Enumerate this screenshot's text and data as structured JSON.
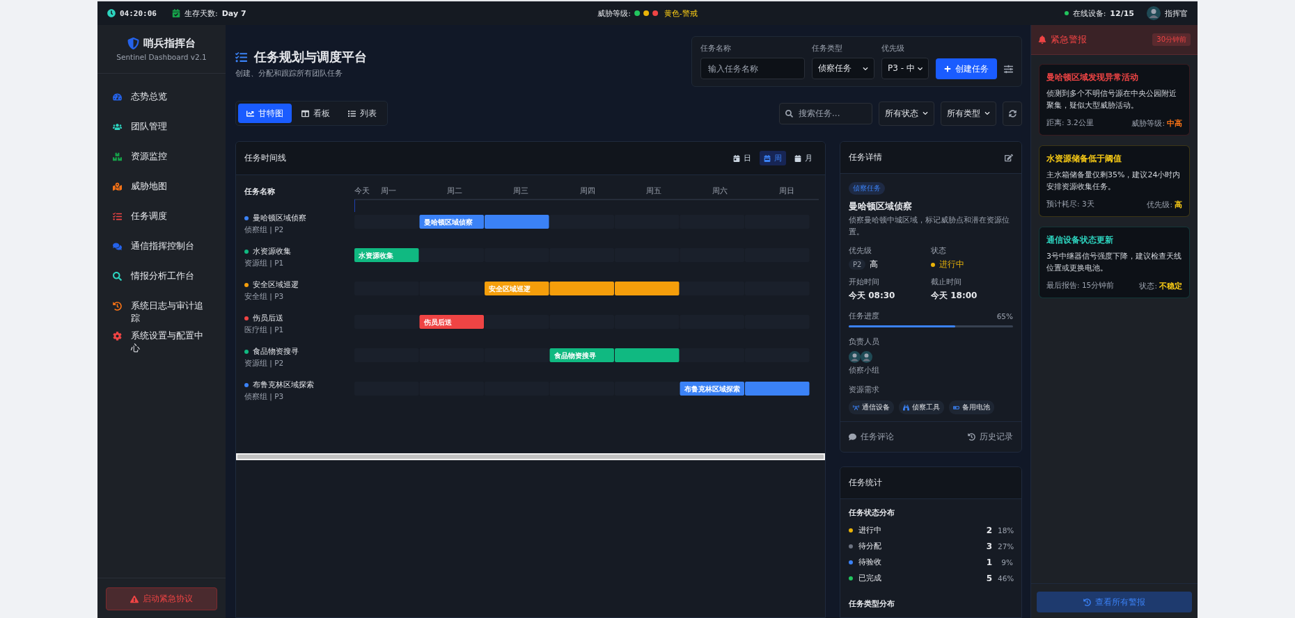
{
  "top_bar": {
    "clock": "04:20:06",
    "survival_label": "生存天数:",
    "survival_value": "Day 7",
    "threat_label": "威胁等级:",
    "threat_dots": [
      {
        "color": "#22c55e"
      },
      {
        "color": "#eab308"
      },
      {
        "color": "#ef4444"
      }
    ],
    "threat_text": "黄色-警戒",
    "devices_label": "在线设备:",
    "devices_value": "12/15",
    "user": "指挥官"
  },
  "sidebar": {
    "title": "哨兵指挥台",
    "subtitle": "Sentinel Dashboard v2.1",
    "items": [
      {
        "label": "态势总览",
        "color": "#2563eb",
        "selected": false
      },
      {
        "label": "团队管理",
        "color": "#2dd4bf",
        "selected": false
      },
      {
        "label": "资源监控",
        "color": "#16a34a",
        "selected": false
      },
      {
        "label": "威胁地图",
        "color": "#f97316",
        "selected": false
      },
      {
        "label": "任务调度",
        "color": "#ef4444",
        "selected": false
      },
      {
        "label": "通信指挥控制台",
        "color": "#2563eb",
        "selected": false
      },
      {
        "label": "情报分析工作台",
        "color": "#2dd4bf",
        "selected": false
      },
      {
        "label": "系统日志与审计追踪",
        "color": "#f97316",
        "selected": false
      },
      {
        "label": "系统设置与配置中心",
        "color": "#ef4444",
        "selected": false
      }
    ],
    "emergency_button": "启动紧急协议"
  },
  "header": {
    "title": "任务规划与调度平台",
    "subtitle": "创建、分配和跟踪所有团队任务"
  },
  "create_form": {
    "name_label": "任务名称",
    "name_placeholder": "输入任务名称",
    "type_label": "任务类型",
    "type_value": "侦察任务",
    "priority_label": "优先级",
    "priority_value": "P3 - 中",
    "create_button": "创建任务"
  },
  "view_tabs": [
    {
      "label": "甘特图",
      "selected": true
    },
    {
      "label": "看板",
      "selected": false
    },
    {
      "label": "列表",
      "selected": false
    }
  ],
  "filters": {
    "search_placeholder": "搜索任务...",
    "status_value": "所有状态",
    "type_value": "所有类型"
  },
  "gantt": {
    "title": "任务时间线",
    "scales": [
      {
        "label": "日",
        "selected": false
      },
      {
        "label": "周",
        "selected": true
      },
      {
        "label": "月",
        "selected": false
      }
    ],
    "name_header": "任务名称",
    "days": [
      "今天",
      "周一",
      "周二",
      "周三",
      "周四",
      "周五",
      "周六",
      "周日"
    ],
    "tasks": [
      {
        "name": "曼哈顿区域侦察",
        "meta": "侦察组 | P2",
        "color": "#3b82f6",
        "bar_label": "曼哈顿区域侦察",
        "days_active": [
          false,
          true,
          true,
          false,
          false,
          false,
          false
        ]
      },
      {
        "name": "水资源收集",
        "meta": "资源组 | P1",
        "color": "#10b981",
        "bar_label": "水资源收集",
        "days_active": [
          true,
          false,
          false,
          false,
          false,
          false,
          false
        ]
      },
      {
        "name": "安全区域巡逻",
        "meta": "安全组 | P3",
        "color": "#f59e0b",
        "bar_label": "安全区域巡逻",
        "days_active": [
          false,
          false,
          true,
          true,
          true,
          false,
          false
        ]
      },
      {
        "name": "伤员后送",
        "meta": "医疗组 | P1",
        "color": "#ef4444",
        "bar_label": "伤员后送",
        "days_active": [
          false,
          true,
          false,
          false,
          false,
          false,
          false
        ]
      },
      {
        "name": "食品物资搜寻",
        "meta": "资源组 | P2",
        "color": "#10b981",
        "bar_label": "食品物资搜寻",
        "days_active": [
          false,
          false,
          false,
          true,
          true,
          false,
          false
        ]
      },
      {
        "name": "布鲁克林区域探索",
        "meta": "侦察组 | P3",
        "color": "#3b82f6",
        "bar_label": "布鲁克林区域探索",
        "days_active": [
          false,
          false,
          false,
          false,
          false,
          true,
          true
        ]
      }
    ]
  },
  "details": {
    "title": "任务详情",
    "tag": "侦察任务",
    "name": "曼哈顿区域侦察",
    "description": "侦察曼哈顿中城区域，标记威胁点和潜在资源位置。",
    "priority_label": "优先级",
    "priority_code": "P2",
    "priority_text": "高",
    "status_label": "状态",
    "status": {
      "text": "进行中",
      "color": "#eab308"
    },
    "start_label": "开始时间",
    "start_value": "今天 08:30",
    "end_label": "截止时间",
    "end_value": "今天 18:00",
    "progress_label": "任务进度",
    "progress_text": "65%",
    "level": 0.65,
    "people_label": "负责人员",
    "team": "侦察小组",
    "resources_label": "资源需求",
    "resources": [
      "通信设备",
      "侦察工具",
      "备用电池"
    ],
    "comment": "任务评论",
    "history": "历史记录"
  },
  "stats": {
    "title": "任务统计",
    "status_heading": "任务状态分布",
    "rows": [
      {
        "label": "进行中",
        "count": "2",
        "percent": "18%",
        "color": "#eab308"
      },
      {
        "label": "待分配",
        "count": "3",
        "percent": "27%",
        "color": "#6b7280"
      },
      {
        "label": "待验收",
        "count": "1",
        "percent": "9%",
        "color": "#3b82f6"
      },
      {
        "label": "已完成",
        "count": "5",
        "percent": "46%",
        "color": "#22c55e"
      }
    ],
    "type_heading": "任务类型分布"
  },
  "alerts": {
    "title": "紧急警报",
    "time": "30分钟前",
    "items": [
      {
        "title": "曼哈顿区域发现异常活动",
        "color": "#ef4444",
        "body": "侦测到多个不明信号源在中央公园附近聚集，疑似大型威胁活动。",
        "left": "距离: 3.2公里",
        "right_label": "威胁等级:",
        "value": {
          "text": "中高",
          "color": "#f97316"
        }
      },
      {
        "title": "水资源储备低于阈值",
        "color": "#facc15",
        "body": "主水箱储备量仅剩35%，建议24小时内安排资源收集任务。",
        "left": "预计耗尽: 3天",
        "right_label": "优先级:",
        "value": {
          "text": "高",
          "color": "#facc15"
        }
      },
      {
        "title": "通信设备状态更新",
        "color": "#2dd4bf",
        "body": "3号中继器信号强度下降，建议检查天线位置或更换电池。",
        "left": "最后报告: 15分钟前",
        "right_label": "状态:",
        "value": {
          "text": "不稳定",
          "color": "#facc15"
        }
      }
    ],
    "view_all": "查看所有警报"
  }
}
